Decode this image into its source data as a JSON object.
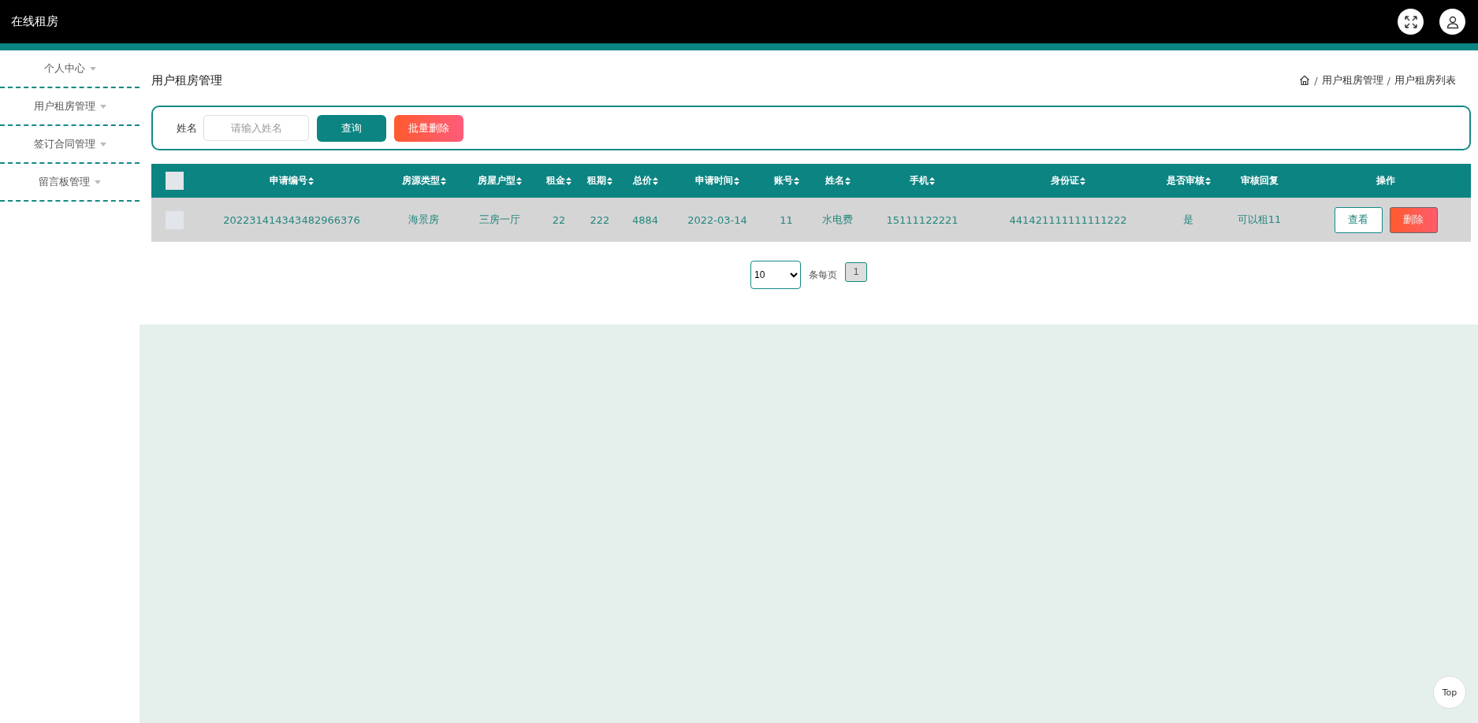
{
  "header": {
    "title": "在线租房"
  },
  "sidebar": {
    "items": [
      {
        "label": "个人中心"
      },
      {
        "label": "用户租房管理"
      },
      {
        "label": "签订合同管理"
      },
      {
        "label": "留言板管理"
      }
    ]
  },
  "page": {
    "title": "用户租房管理",
    "breadcrumb_separator": "/",
    "breadcrumb": [
      "用户租房管理",
      "用户租房列表"
    ]
  },
  "search": {
    "label": "姓名",
    "placeholder": "请输入姓名",
    "buttons": [
      {
        "label": "查询",
        "kind": "primary"
      },
      {
        "label": "批量删除",
        "kind": "danger"
      }
    ]
  },
  "table": {
    "select_all_checked": false,
    "columns": [
      {
        "label": "申请编号",
        "sortable": true
      },
      {
        "label": "房源类型",
        "sortable": true
      },
      {
        "label": "房屋户型",
        "sortable": true
      },
      {
        "label": "租金",
        "sortable": true
      },
      {
        "label": "租期",
        "sortable": true
      },
      {
        "label": "总价",
        "sortable": true
      },
      {
        "label": "申请时间",
        "sortable": true
      },
      {
        "label": "账号",
        "sortable": true
      },
      {
        "label": "姓名",
        "sortable": true
      },
      {
        "label": "手机",
        "sortable": true
      },
      {
        "label": "身份证",
        "sortable": true
      },
      {
        "label": "是否审核",
        "sortable": true
      },
      {
        "label": "审核回复",
        "sortable": false
      },
      {
        "label": "操作",
        "sortable": false
      }
    ],
    "rows": [
      {
        "checked": false,
        "cells": [
          "202231414343482966376",
          "海景房",
          "三房一厅",
          "22",
          "222",
          "4884",
          "2022-03-14",
          "11",
          "水电费",
          "15111122221",
          "441421111111111222",
          "是",
          "可以租11"
        ],
        "actions": [
          {
            "label": "查看",
            "kind": "view"
          },
          {
            "label": "删除",
            "kind": "delete"
          }
        ]
      }
    ]
  },
  "pagination": {
    "page_size": "10",
    "per_page_label": "条每页",
    "pages": [
      {
        "label": "1",
        "selected": true
      }
    ]
  },
  "back_to_top": {
    "label": "Top"
  }
}
